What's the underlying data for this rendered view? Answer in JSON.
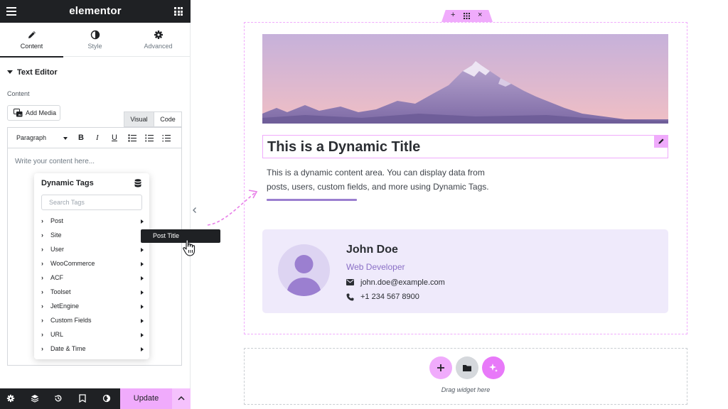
{
  "app": {
    "logo": "elementor"
  },
  "tabs": [
    {
      "label": "Content",
      "icon": "pencil-icon",
      "active": true
    },
    {
      "label": "Style",
      "icon": "contrast-icon",
      "active": false
    },
    {
      "label": "Advanced",
      "icon": "gear-icon",
      "active": false
    }
  ],
  "section": {
    "title": "Text Editor",
    "content_label": "Content"
  },
  "editor": {
    "add_media_label": "Add Media",
    "visual_tab": "Visual",
    "code_tab": "Code",
    "format_select": "Paragraph",
    "placeholder": "Write your content here..."
  },
  "dynamic_tags": {
    "title": "Dynamic Tags",
    "search_placeholder": "Search Tags",
    "items": [
      "Post",
      "Site",
      "User",
      "WooCommerce",
      "ACF",
      "Toolset",
      "JetEngine",
      "Custom Fields",
      "URL",
      "Date & Time"
    ],
    "tooltip": "Post Title"
  },
  "bottom_bar": {
    "update_label": "Update",
    "icons": [
      "settings-icon",
      "layers-icon",
      "history-icon",
      "navigator-icon",
      "preview-icon"
    ]
  },
  "canvas": {
    "title": "This is a Dynamic Title",
    "description": "This is a dynamic content area. You can display data from posts, users, custom fields, and more using Dynamic Tags.",
    "profile": {
      "name": "John Doe",
      "role": "Web Developer",
      "email": "john.doe@example.com",
      "phone": "+1 234 567 8900"
    },
    "drop_zone_text": "Drag widget here"
  },
  "colors": {
    "accent_pink": "#f0abfc",
    "dark": "#1f2124",
    "purple": "#8a6fc6",
    "card_bg": "#efeafb"
  }
}
